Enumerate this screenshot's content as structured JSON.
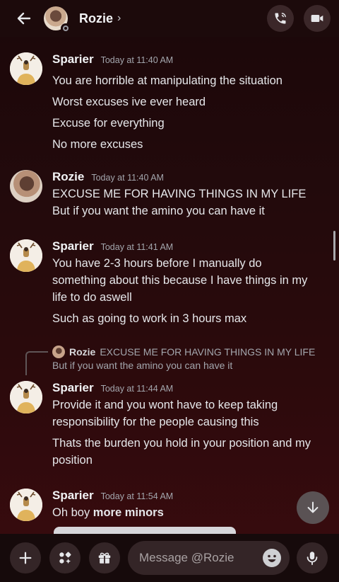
{
  "header": {
    "title": "Rozie",
    "chevron": "›",
    "back_icon": "arrow-left-icon",
    "call_icon": "phone-icon",
    "video_icon": "video-camera-icon"
  },
  "messages": [
    {
      "author": "Sparier",
      "timestamp": "Today at 11:40 AM",
      "lines": [
        "You are horrible at manipulating the situation",
        "Worst excuses ive ever heard",
        "Excuse for everything",
        "No more excuses"
      ]
    },
    {
      "author": "Rozie",
      "timestamp": "Today at 11:40 AM",
      "lines": [
        "EXCUSE ME FOR HAVING THINGS IN MY LIFE",
        "But if you want the amino you can have it"
      ]
    },
    {
      "author": "Sparier",
      "timestamp": "Today at 11:41 AM",
      "lines": [
        "You have 2-3 hours before I manually do",
        "something about this because I have things in my",
        "life to do aswell",
        "Such as going to work in 3 hours max"
      ]
    },
    {
      "author": "Sparier",
      "timestamp": "Today at 11:44 AM",
      "reply": {
        "author": "Rozie",
        "line1": "EXCUSE ME FOR HAVING THINGS IN MY LIFE",
        "line2": "But if you want the amino you can have it"
      },
      "lines": [
        "Provide it and you wont have to keep taking",
        "responsibility for the people causing this",
        "Thats the burden you hold in your position and my",
        "position"
      ]
    },
    {
      "author": "Sparier",
      "timestamp": "Today at 11:54 AM",
      "text_prefix": "Oh boy ",
      "text_bold": "more minors"
    }
  ],
  "composer": {
    "placeholder": "Message @Rozie",
    "buttons": [
      "plus-icon",
      "apps-icon",
      "gift-icon",
      "emoji-icon",
      "microphone-icon"
    ]
  },
  "colors": {
    "background_top": "#1b0709",
    "background_bottom": "#3a0b0e",
    "text": "#f2f3f5",
    "muted": "#a3a6ad"
  }
}
